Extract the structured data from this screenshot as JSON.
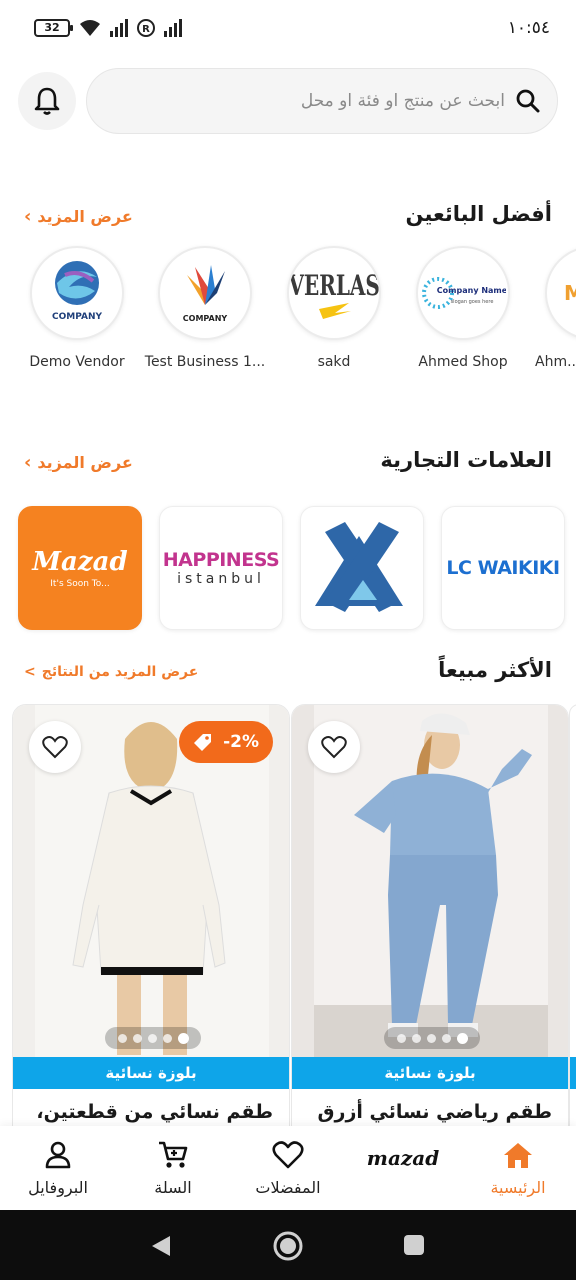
{
  "status_bar": {
    "battery": "32",
    "time": "١٠:٥٤"
  },
  "search": {
    "placeholder": "ابحث عن منتج او فئة او محل"
  },
  "sellers_section": {
    "title": "أفضل البائعين",
    "more_label": "عرض المزيد",
    "items": [
      {
        "name": "Demo Vendor",
        "logo_text": "COMPANY"
      },
      {
        "name": "Test Business 1...",
        "logo_text": "COMPANY"
      },
      {
        "name": "sakd",
        "logo_text": "EVERLAST"
      },
      {
        "name": "Ahmed Shop",
        "logo_text": "Company Name",
        "logo_sub": "slogan goes here"
      },
      {
        "name": "Ahm...",
        "logo_text": "M"
      }
    ]
  },
  "brands_section": {
    "title": "العلامات التجارية",
    "more_label": "عرض المزيد",
    "items": [
      {
        "name": "Mazad",
        "tagline": "It's Soon To..."
      },
      {
        "name": "HAPPINESS",
        "sub": "istanbul"
      },
      {
        "name": ""
      },
      {
        "name": "LC WAIKIKI"
      }
    ]
  },
  "bestsellers_section": {
    "title": "الأكثر مبيعاً",
    "more_label": "عرض المزيد من النتائج"
  },
  "products": [
    {
      "discount": "-2%",
      "category": "بلوزة نسائية",
      "title": "طقم نسائي من قطعتين،",
      "image_colors": {
        "bg": "#f1efec",
        "primary": "#f4f1ea"
      }
    },
    {
      "category": "بلوزة نسائية",
      "title": "طقم رياضي نسائي أزرق",
      "image_colors": {
        "bg": "#eae6e3",
        "primary": "#8fb1d6"
      }
    }
  ],
  "bottom_nav": {
    "home": "الرئيسية",
    "brand_logo": "mazad",
    "favorites": "المفضلات",
    "cart": "السلة",
    "profile": "البروفايل"
  },
  "colors": {
    "accent": "#f07a2a",
    "category_bar": "#0ea5e9",
    "discount": "#f26a1b"
  }
}
